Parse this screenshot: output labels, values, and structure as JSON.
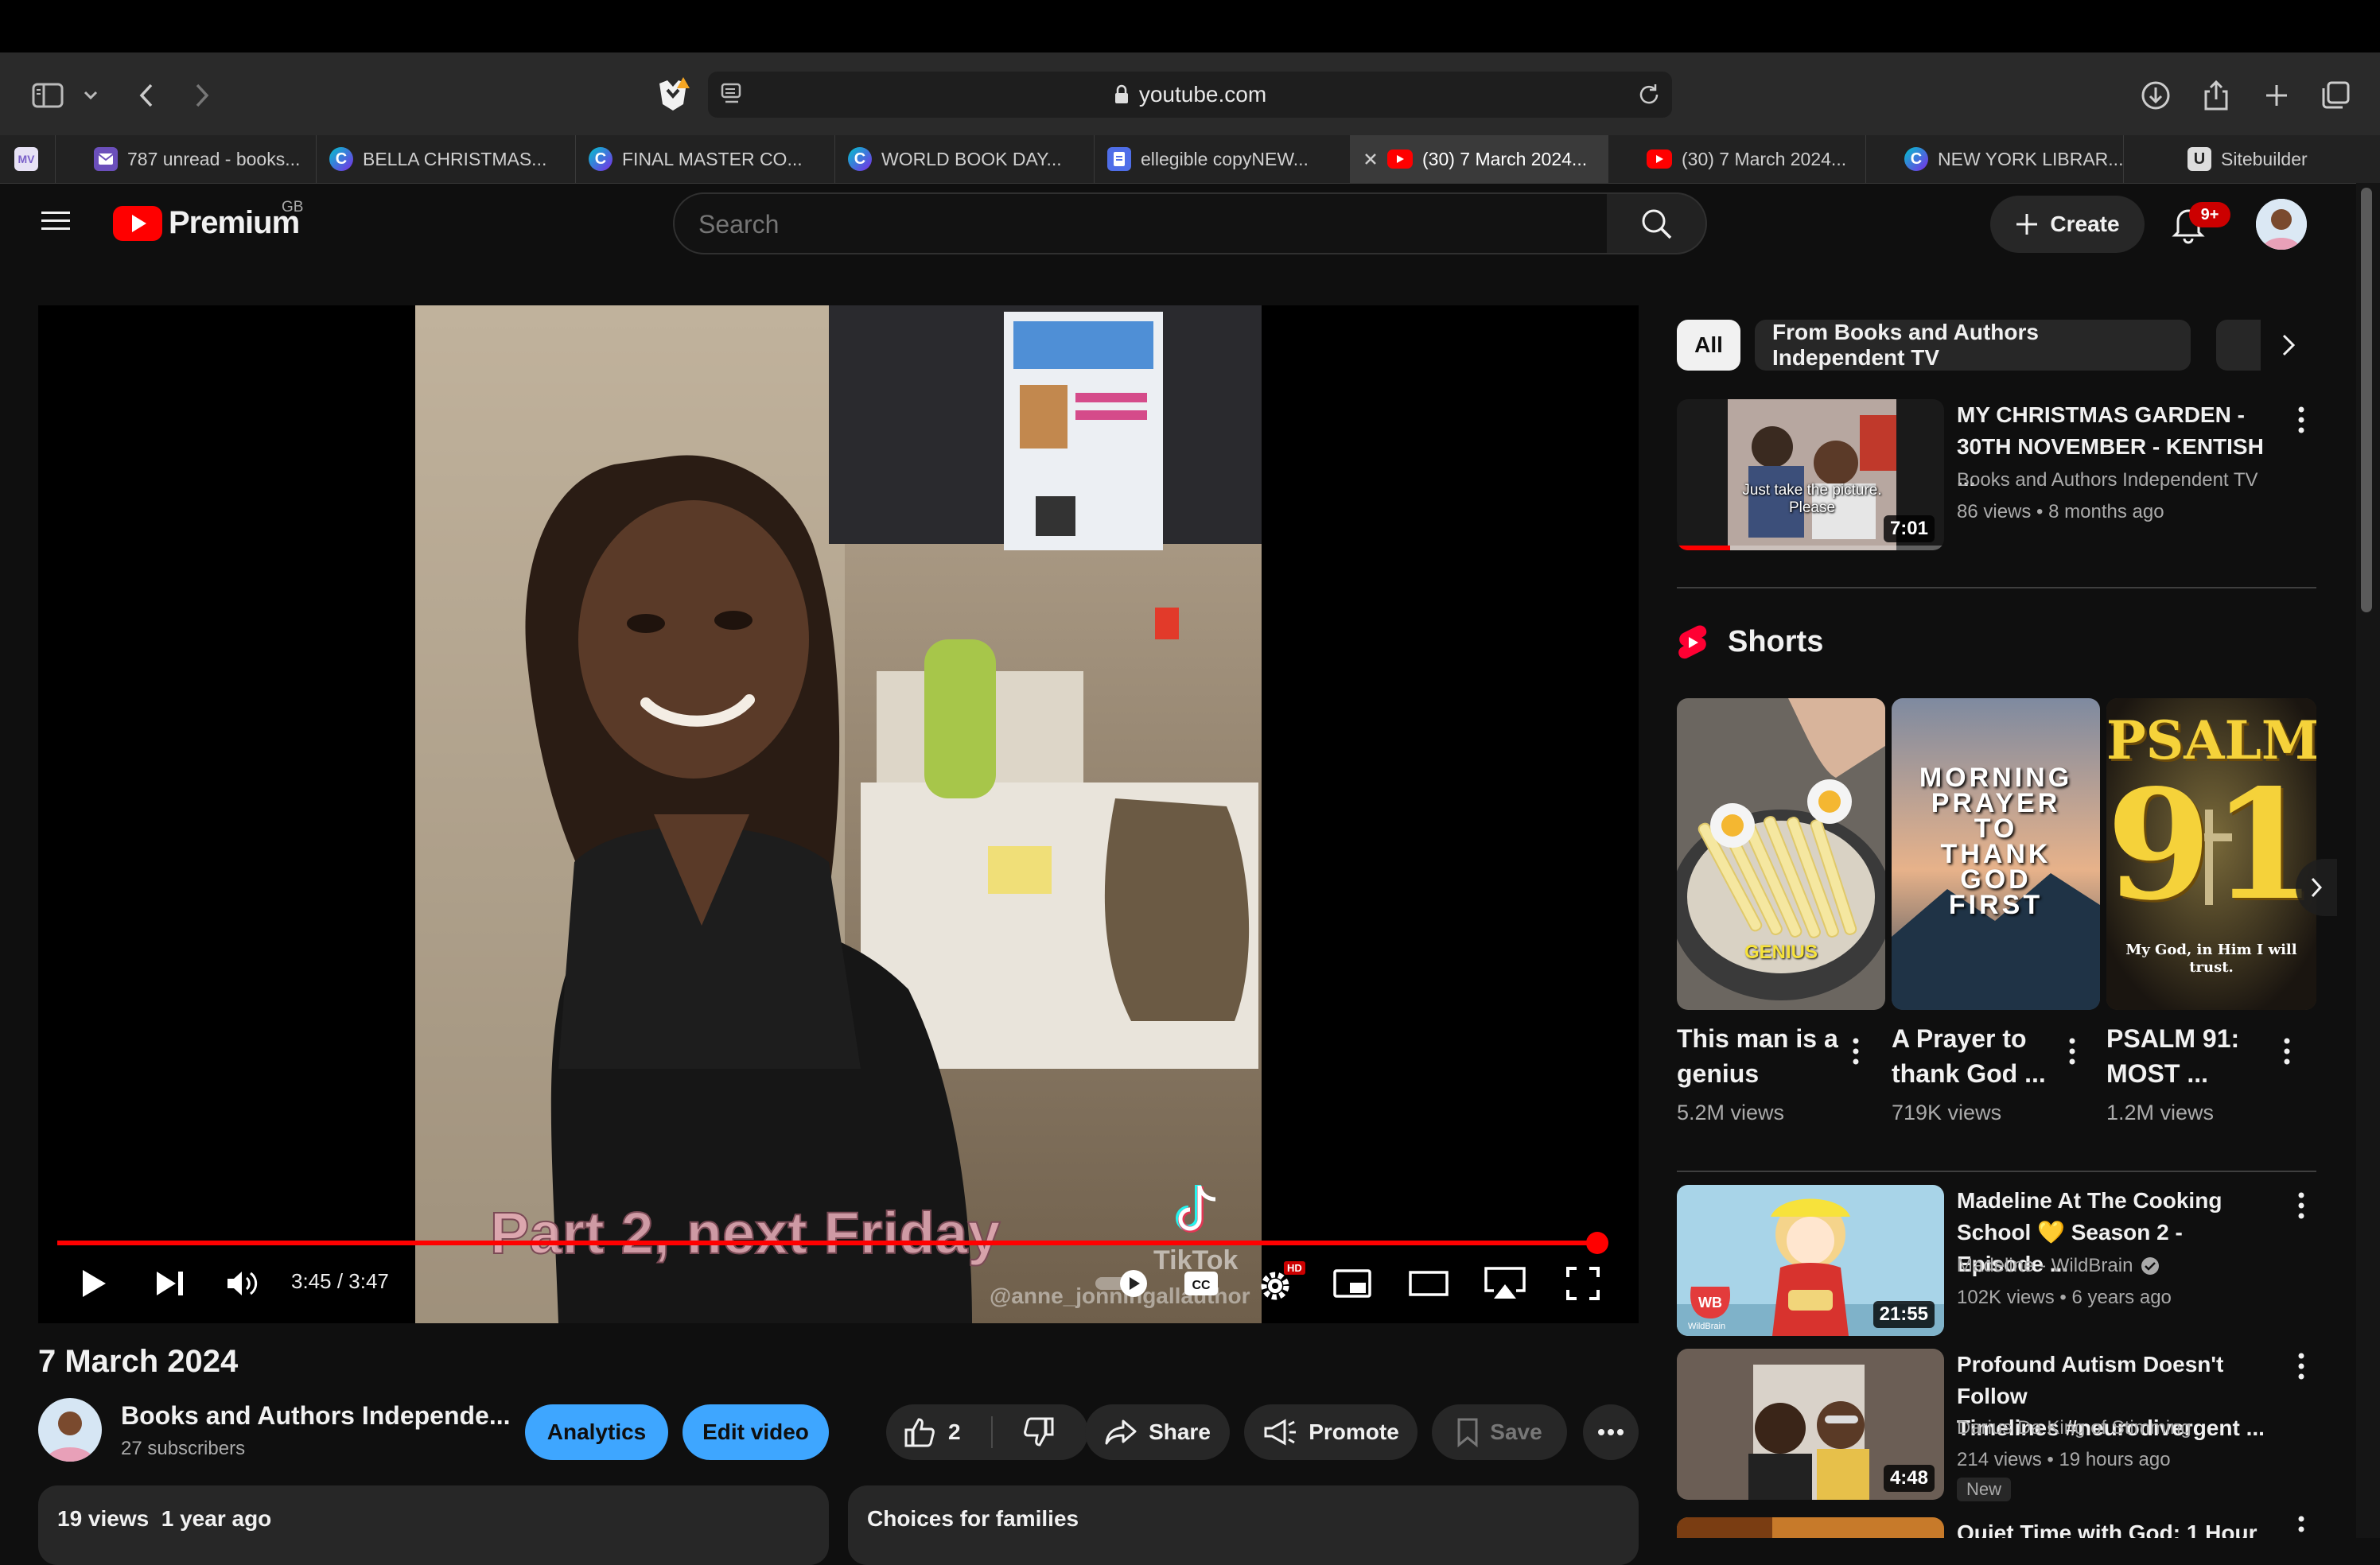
{
  "browser": {
    "url": "youtube.com",
    "tabs": [
      {
        "label": "787 unread - books...",
        "icon": "mail-icon"
      },
      {
        "label": "BELLA CHRISTMAS...",
        "icon": "canva-icon"
      },
      {
        "label": "FINAL MASTER CO...",
        "icon": "canva-icon"
      },
      {
        "label": "WORLD BOOK DAY...",
        "icon": "canva-icon"
      },
      {
        "label": "ellegible copyNEW...",
        "icon": "docs-icon"
      },
      {
        "label": "(30) 7 March 2024...",
        "icon": "youtube-icon",
        "active": true
      },
      {
        "label": "(30) 7 March 2024...",
        "icon": "youtube-icon"
      },
      {
        "label": "NEW YORK LIBRAR...",
        "icon": "canva-icon"
      },
      {
        "label": "Sitebuilder",
        "icon": "sitebuilder-icon"
      }
    ],
    "pinned_tab_label": "MV"
  },
  "header": {
    "logo_text": "Premium",
    "region": "GB",
    "search_placeholder": "Search",
    "create_label": "Create",
    "notification_badge": "9+"
  },
  "player": {
    "overlay_caption": "Part 2, next Friday",
    "tiktok_label": "TikTok",
    "tiktok_handle": "@anne_jonningallauthor",
    "time": "3:45 / 3:47",
    "progress_fraction": 0.991,
    "hd_badge": "HD"
  },
  "video": {
    "title": "7 March 2024",
    "channel_name": "Books and Authors Independe...",
    "subscribers": "27 subscribers",
    "analytics_label": "Analytics",
    "edit_label": "Edit video",
    "likes": "2",
    "share_label": "Share",
    "promote_label": "Promote",
    "save_label": "Save",
    "description": "19 views  1 year ago",
    "families_label": "Choices for families"
  },
  "sidebar": {
    "chips": [
      "All",
      "From Books and Authors Independent TV"
    ],
    "recommendations_top": [
      {
        "title_lines": [
          "MY CHRISTMAS GARDEN -",
          "30TH NOVEMBER - KENTISH ..."
        ],
        "channel": "Books and Authors Independent TV",
        "meta": "86 views • 8 months ago",
        "duration": "7:01",
        "thumb_caption": "Just take the picture. Please",
        "watched_fraction": 0.2
      }
    ],
    "shorts_heading": "Shorts",
    "shorts": [
      {
        "title_lines": [
          "This man is a",
          "genius"
        ],
        "views": "5.2M views",
        "thumb_text": "GENIUS"
      },
      {
        "title_lines": [
          "A Prayer to",
          "thank God ..."
        ],
        "views": "719K views",
        "thumb_text": "MORNING PRAYER TO THANK GOD FIRST"
      },
      {
        "title_lines": [
          "PSALM 91:",
          "MOST ..."
        ],
        "views": "1.2M views",
        "thumb_text": "PSALM 91",
        "thumb_sub": "My God, in Him I will trust."
      }
    ],
    "recommendations": [
      {
        "title_lines": [
          "Madeline At The Cooking",
          "School 💛 Season 2 - Episode ..."
        ],
        "channel": "Madeline - WildBrain",
        "verified": true,
        "meta": "102K views • 6 years ago",
        "duration": "21:55",
        "thumb_brand": "WildBrain"
      },
      {
        "title_lines": [
          "Profound Autism Doesn't Follow",
          "Timelines #neurodivergent ..."
        ],
        "channel": "Darius Da King of Stimming",
        "meta": "214 views • 19 hours ago",
        "duration": "4:48",
        "badge": "New"
      },
      {
        "title_lines": [
          "Quiet Time with God: 1 Hour"
        ]
      }
    ]
  },
  "colors": {
    "yt_red": "#ff0000",
    "accent_blue": "#3ea6ff",
    "bg": "#0f0f0f",
    "chip_bg": "#272727"
  }
}
